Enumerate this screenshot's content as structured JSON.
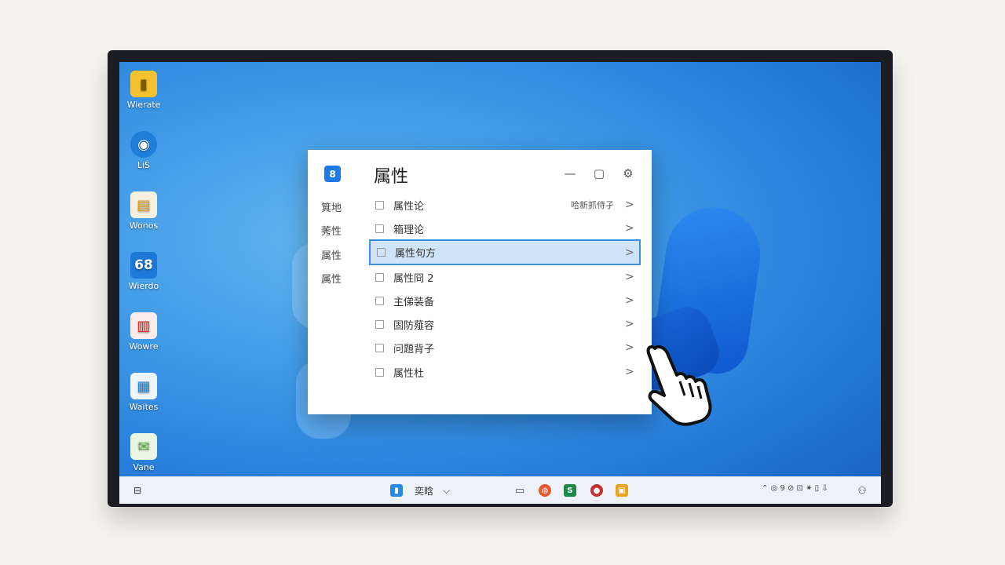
{
  "desktop": {
    "icons": [
      {
        "label": "Wierate",
        "icon": "folder-zip-icon",
        "glyph": "▮",
        "color": "#f2c230"
      },
      {
        "label": "LiS",
        "icon": "media-player-icon",
        "glyph": "◉",
        "color": "#1f7fd8"
      },
      {
        "label": "Wonos",
        "icon": "spreadsheet-icon",
        "glyph": "▤",
        "color": "#f0b43a"
      },
      {
        "label": "Wierdo",
        "icon": "number-tile-icon",
        "glyph": "68",
        "color": "#1e78d8"
      },
      {
        "label": "Wowre",
        "icon": "document-red-icon",
        "glyph": "▥",
        "color": "#d43a2f"
      },
      {
        "label": "Waites",
        "icon": "table-doc-icon",
        "glyph": "▦",
        "color": "#2e8fd8"
      },
      {
        "label": "Vane",
        "icon": "chat-bubble-icon",
        "glyph": "✉",
        "color": "#53b33f"
      }
    ]
  },
  "window": {
    "app_icon": "8",
    "title": "属性",
    "controls": {
      "minimize": "—",
      "maximize": "▢",
      "close": "⚙"
    },
    "sidebar": [
      "箕地",
      "莠性",
      "属性",
      "属性"
    ],
    "rows": [
      {
        "label": "属性论",
        "extra": "哈新抓侍孑",
        "selected": false
      },
      {
        "label": "箱理论",
        "extra": "",
        "selected": false
      },
      {
        "label": "属性句方",
        "extra": "",
        "selected": true
      },
      {
        "label": "属性冏 2",
        "extra": "",
        "selected": false
      },
      {
        "label": "主俤装备",
        "extra": "",
        "selected": false
      },
      {
        "label": "固防薤容",
        "extra": "",
        "selected": false
      },
      {
        "label": "问題背子",
        "extra": "",
        "selected": false
      },
      {
        "label": "属性杜",
        "extra": "",
        "selected": false
      }
    ],
    "chevron": ">"
  },
  "taskbar": {
    "left_icon": "widgets-icon",
    "search_label": "奕晗",
    "search_chevron": "⌵",
    "pinned": [
      {
        "icon": "window-icon",
        "glyph": "▭",
        "color": "#555555"
      },
      {
        "icon": "browser-icon",
        "glyph": "◍",
        "color": "#e5572c"
      },
      {
        "icon": "sheet-app-icon",
        "glyph": "S",
        "color": "#1d8a4c"
      },
      {
        "icon": "game-app-icon",
        "glyph": "●",
        "color": "#c23232"
      },
      {
        "icon": "folder-app-icon",
        "glyph": "▣",
        "color": "#e5a223"
      }
    ],
    "tray_text": "⌃  ◎ 9 ⊘  ⊡ ⁕ ▯  ⇩"
  },
  "colors": {
    "accent": "#1e7be5",
    "selection": "#cfe4f8",
    "selection_border": "#3e8fd9"
  }
}
